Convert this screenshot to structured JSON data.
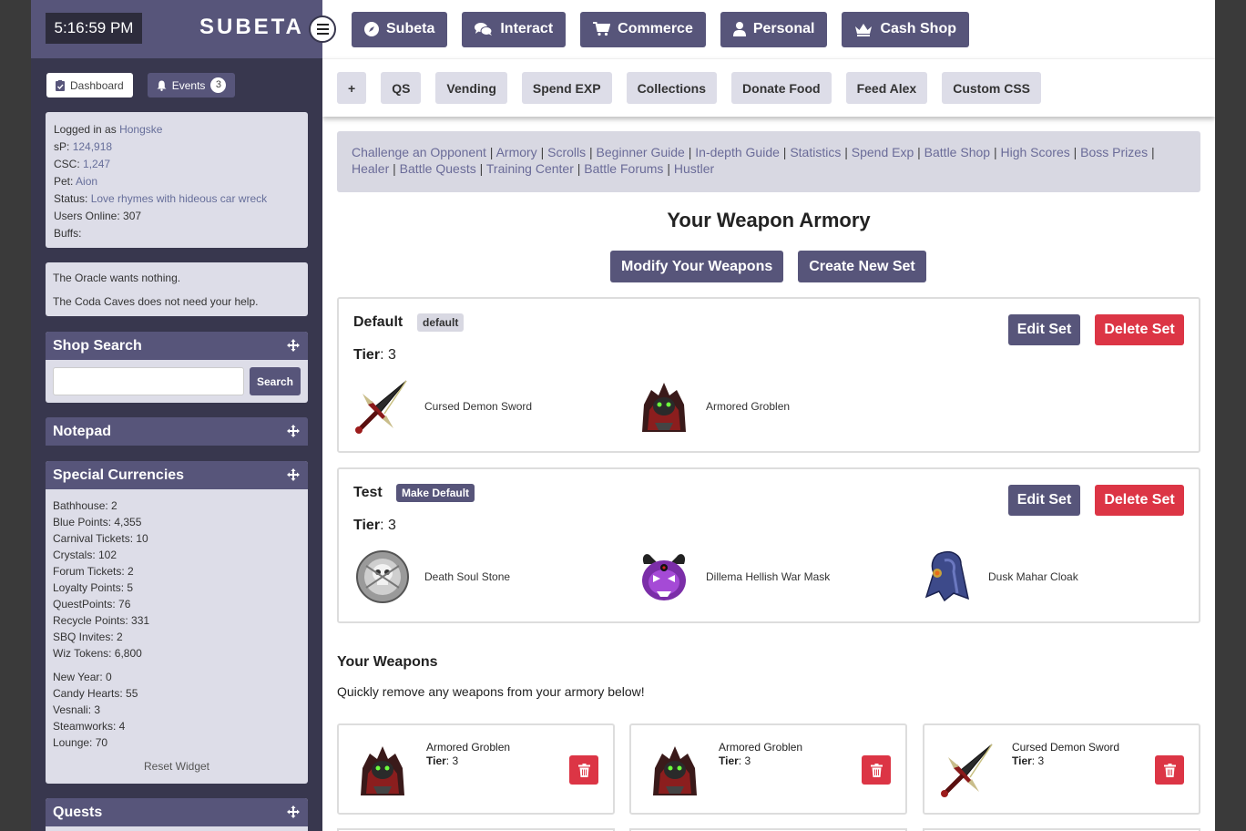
{
  "sidebar": {
    "clock": "5:16:59 PM",
    "logo": "SUBETA",
    "tabs": {
      "dashboard": "Dashboard",
      "events": "Events",
      "events_count": "3"
    },
    "info": {
      "logged_in_label": "Logged in as",
      "username": "Hongske",
      "sp_label": "sP:",
      "sp_value": "124,918",
      "csc_label": "CSC:",
      "csc_value": "1,247",
      "pet_label": "Pet:",
      "pet_value": "Aion",
      "status_label": "Status:",
      "status_value": "Love rhymes with hideous car wreck",
      "users_online": "Users Online: 307",
      "buffs": "Buffs:"
    },
    "oracle": [
      "The Oracle wants nothing.",
      "The Coda Caves does not need your help."
    ],
    "shop_search": {
      "title": "Shop Search",
      "button": "Search",
      "value": ""
    },
    "notepad": {
      "title": "Notepad"
    },
    "special_currencies": {
      "title": "Special Currencies",
      "group1": [
        "Bathhouse: 2",
        "Blue Points: 4,355",
        "Carnival Tickets: 10",
        "Crystals: 102",
        "Forum Tickets: 2",
        "Loyalty Points: 5",
        "QuestPoints: 76",
        "Recycle Points: 331",
        "SBQ Invites: 2",
        "Wiz Tokens: 6,800"
      ],
      "group2": [
        "New Year: 0",
        "Candy Hearts: 55",
        "Vesnali: 3",
        "Steamworks: 4",
        "Lounge: 70"
      ],
      "reset": "Reset Widget"
    },
    "quests": {
      "title": "Quests"
    }
  },
  "topnav": [
    {
      "label": "Subeta",
      "icon": "compass-icon"
    },
    {
      "label": "Interact",
      "icon": "chat-icon"
    },
    {
      "label": "Commerce",
      "icon": "cart-icon"
    },
    {
      "label": "Personal",
      "icon": "user-icon"
    },
    {
      "label": "Cash Shop",
      "icon": "crown-icon"
    }
  ],
  "subnav": [
    "+",
    "QS",
    "Vending",
    "Spend EXP",
    "Collections",
    "Donate Food",
    "Feed Alex",
    "Custom CSS"
  ],
  "battle_links": [
    "Challenge an Opponent",
    "Armory",
    "Scrolls",
    "Beginner Guide",
    "In-depth Guide",
    "Statistics",
    "Spend Exp",
    "Battle Shop",
    "High Scores",
    "Boss Prizes",
    "Healer",
    "Battle Quests",
    "Training Center",
    "Battle Forums",
    "Hustler"
  ],
  "page": {
    "title": "Your Weapon Armory",
    "modify_button": "Modify Your Weapons",
    "create_button": "Create New Set",
    "edit_label": "Edit Set",
    "delete_label": "Delete Set",
    "tier_label": "Tier",
    "sets": [
      {
        "name": "Default",
        "badge": "default",
        "tier": ": 3",
        "items": [
          "Cursed Demon Sword",
          "Armored Groblen"
        ]
      },
      {
        "name": "Test",
        "badge": "Make Default",
        "tier": ": 3",
        "items": [
          "Death Soul Stone",
          "Dillema Hellish War Mask",
          "Dusk Mahar Cloak"
        ]
      }
    ],
    "weapons_title": "Your Weapons",
    "weapons_note": "Quickly remove any weapons from your armory below!",
    "weapons": [
      {
        "name": "Armored Groblen",
        "tier_label": "Tier",
        "tier": ": 3"
      },
      {
        "name": "Armored Groblen",
        "tier_label": "Tier",
        "tier": ": 3"
      },
      {
        "name": "Cursed Demon Sword",
        "tier_label": "Tier",
        "tier": ": 3"
      }
    ]
  },
  "colors": {
    "primary": "#57557a",
    "sidebar": "#38374e",
    "danger": "#dc3545",
    "panel": "#dddde8",
    "link": "#6a6b98"
  }
}
